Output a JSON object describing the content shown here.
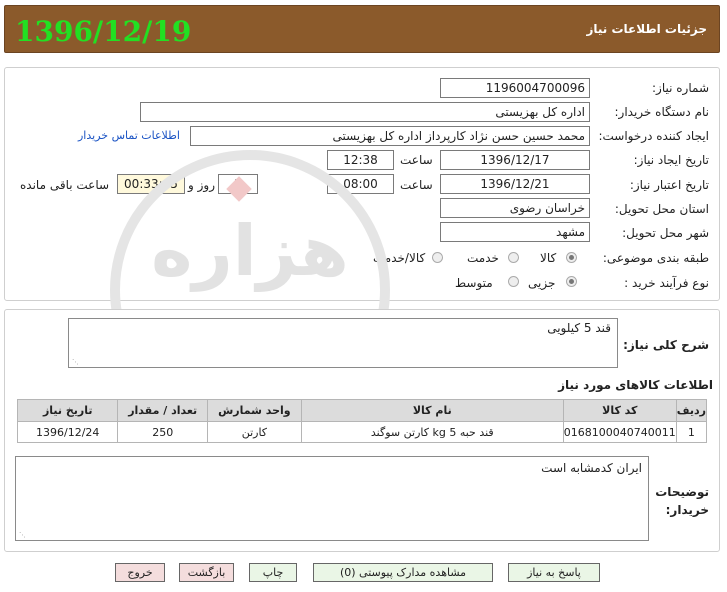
{
  "header": {
    "date": "1396/12/19",
    "title": "جزئیات اطلاعات نیاز"
  },
  "form": {
    "need_number": {
      "label": "شماره نیاز:",
      "value": "1196004700096"
    },
    "buyer_org": {
      "label": "نام دستگاه خریدار:",
      "value": "اداره کل بهزیستی"
    },
    "requester": {
      "label": "ایجاد کننده درخواست:",
      "value": "محمد حسین حسن نژاد کارپرداز اداره کل بهزیستی",
      "contact_link": "اطلاعات تماس خریدار"
    },
    "create_date": {
      "label": "تاریخ ایجاد نیاز:",
      "date": "1396/12/17",
      "time_label": "ساعت",
      "time": "12:38"
    },
    "validity_date": {
      "label": "تاریخ اعتبار نیاز:",
      "date": "1396/12/21",
      "time_label": "ساعت",
      "time": "08:00",
      "days": "2",
      "days_label": "روز و",
      "remaining": "00:33:05",
      "remaining_label": "ساعت باقی مانده"
    },
    "province": {
      "label": "استان محل تحویل:",
      "value": "خراسان رضوی"
    },
    "city": {
      "label": "شهر محل تحویل:",
      "value": "مشهد"
    },
    "category": {
      "label": "طبقه بندی موضوعی:",
      "options": [
        "کالا",
        "خدمت",
        "کالا/خدمت"
      ],
      "selected": "کالا"
    },
    "purchase_type": {
      "label": "نوع فرآیند خرید :",
      "options": [
        "جزیی",
        "متوسط"
      ],
      "selected": "جزیی"
    }
  },
  "description": {
    "label": "شرح کلی نیاز:",
    "value": "قند 5 کیلویی"
  },
  "items_section": {
    "title": "اطلاعات کالاهای مورد نیاز",
    "columns": [
      "ردیف",
      "کد کالا",
      "نام کالا",
      "واحد شمارش",
      "تعداد / مقدار",
      "تاریخ نیاز"
    ],
    "rows": [
      [
        "1",
        "0168100040740011",
        "قند حبه 5 kg کارتن سوگند",
        "کارتن",
        "250",
        "1396/12/24"
      ]
    ]
  },
  "buyer_notes": {
    "label": "توضیحات خریدار:",
    "value": "ایران کدمشابه است"
  },
  "buttons": {
    "reply": "پاسخ به نیاز",
    "attachments": "مشاهده مدارک پیوستی (0)",
    "print": "چاپ",
    "back": "بازگشت",
    "exit": "خروج"
  },
  "watermark_text": [
    "هزاره",
    "ارتباط گستران"
  ]
}
